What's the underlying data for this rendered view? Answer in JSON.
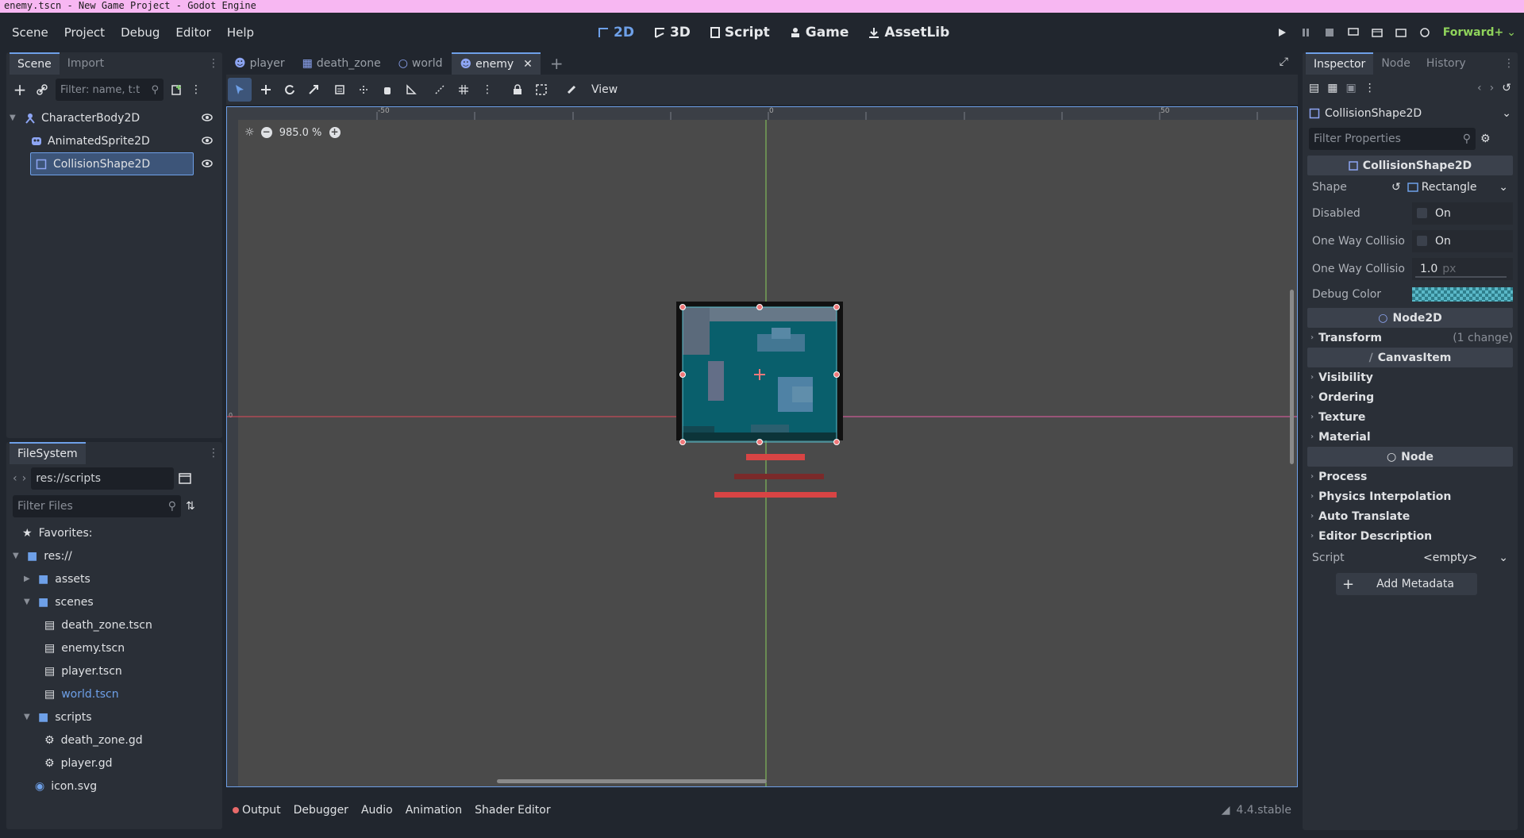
{
  "window": {
    "title": "enemy.tscn - New Game Project - Godot Engine"
  },
  "menu": [
    "Scene",
    "Project",
    "Debug",
    "Editor",
    "Help"
  ],
  "workspaces": {
    "w2d": "2D",
    "w3d": "3D",
    "script": "Script",
    "game": "Game",
    "assetlib": "AssetLib"
  },
  "renderer": "Forward+",
  "scene_dock": {
    "tab_scene": "Scene",
    "tab_import": "Import",
    "filter_placeholder": "Filter: name, t:t",
    "nodes": [
      {
        "label": "CharacterBody2D"
      },
      {
        "label": "AnimatedSprite2D"
      },
      {
        "label": "CollisionShape2D"
      }
    ]
  },
  "filesystem": {
    "title": "FileSystem",
    "path": "res://scripts",
    "filter_placeholder": "Filter Files",
    "favorites": "Favorites:",
    "root": "res://",
    "assets": "assets",
    "scenes": "scenes",
    "scene_files": [
      "death_zone.tscn",
      "enemy.tscn",
      "player.tscn",
      "world.tscn"
    ],
    "scripts": "scripts",
    "script_files": [
      "death_zone.gd",
      "player.gd"
    ],
    "icon": "icon.svg"
  },
  "editor_tabs": [
    "player",
    "death_zone",
    "world",
    "enemy"
  ],
  "toolbar": {
    "view": "View"
  },
  "viewport": {
    "zoom": "985.0 %",
    "ruler_labels": [
      "-50",
      "0",
      "50"
    ],
    "ruler_v_label": "0"
  },
  "bottom": {
    "tabs": [
      "Output",
      "Debugger",
      "Audio",
      "Animation",
      "Shader Editor"
    ],
    "version": "4.4.stable"
  },
  "inspector": {
    "tabs": [
      "Inspector",
      "Node",
      "History"
    ],
    "node": "CollisionShape2D",
    "filter_placeholder": "Filter Properties",
    "section_main": "CollisionShape2D",
    "shape_label": "Shape",
    "shape_value": "Rectangle",
    "disabled_label": "Disabled",
    "disabled_value": "On",
    "oneway_label": "One Way Collisio",
    "oneway_value": "On",
    "oneway_margin_label": "One Way Collisio",
    "oneway_margin_value": "1.0",
    "oneway_margin_unit": "px",
    "debug_color_label": "Debug Color",
    "section_node2d": "Node2D",
    "transform": "Transform",
    "transform_note": "(1 change)",
    "section_canvas": "CanvasItem",
    "visibility": "Visibility",
    "ordering": "Ordering",
    "texture": "Texture",
    "material": "Material",
    "section_node": "Node",
    "process": "Process",
    "physics_interp": "Physics Interpolation",
    "auto_translate": "Auto Translate",
    "editor_desc": "Editor Description",
    "script_label": "Script",
    "script_value": "<empty>",
    "add_metadata": "Add Metadata"
  },
  "colors": {
    "accent": "#6ea0e8",
    "bg": "#21262e",
    "panel": "#2a2f37",
    "viewport": "#4a4a4a",
    "renderer": "#8fd35b"
  }
}
